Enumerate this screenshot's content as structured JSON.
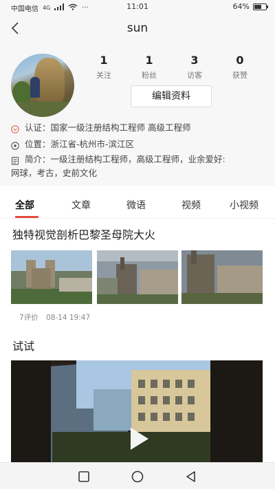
{
  "status_bar": {
    "carrier": "中国电信",
    "network": "4G",
    "more": "···",
    "time": "11:01",
    "battery": "64%",
    "battery_level": 0.64
  },
  "header": {
    "title": "sun"
  },
  "profile": {
    "stats": [
      {
        "value": "1",
        "label": "关注"
      },
      {
        "value": "1",
        "label": "粉丝"
      },
      {
        "value": "3",
        "label": "访客"
      },
      {
        "value": "0",
        "label": "获赞"
      }
    ],
    "edit_label": "编辑资料",
    "verification": "认证：国家一级注册结构工程师 高级工程师",
    "location": "位置：浙江省-杭州市-滨江区",
    "bio_line1": "简介：一级注册结构工程师，高级工程师，业余爱好:",
    "bio_line2": "网球，考古，史前文化"
  },
  "tabs": [
    "全部",
    "文章",
    "微语",
    "视频",
    "小视频"
  ],
  "posts": [
    {
      "title": "独特视觉剖析巴黎圣母院大火",
      "comments": "7评价",
      "date": "08-14 19:47"
    },
    {
      "title": "试试"
    }
  ],
  "colors": {
    "accent": "#e54b3a",
    "header_bg": "#f7f7f7",
    "icon_red": "#e06a5e"
  }
}
